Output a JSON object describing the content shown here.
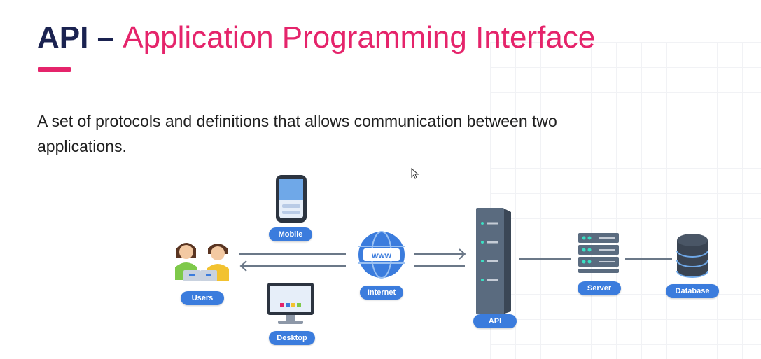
{
  "title": {
    "strong": "API",
    "dash": " – ",
    "accent": "Application Programming Interface"
  },
  "description": "A set of protocols and definitions that allows communication between two applications.",
  "diagram": {
    "nodes": {
      "mobile": "Mobile",
      "users": "Users",
      "desktop": "Desktop",
      "internet": "Internet",
      "globe_text": "www",
      "api": "API",
      "server": "Server",
      "database": "Database"
    }
  },
  "colors": {
    "title_dark": "#1a2250",
    "accent_pink": "#e5246b",
    "pill_blue": "#3b7cdd"
  }
}
